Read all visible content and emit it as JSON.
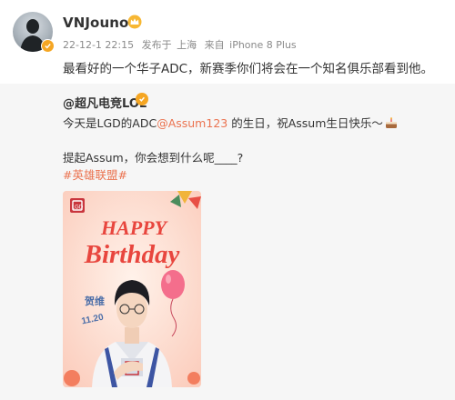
{
  "post": {
    "username": "VNJounoo",
    "date": "22-12-1 22:15",
    "source_prefix": "发布于",
    "location": "上海",
    "device_prefix": "来自",
    "device": "iPhone 8 Plus",
    "text": "最看好的一个华子ADC，新赛季你们将会在一个知名俱乐部看到他。"
  },
  "repost": {
    "author": "@超凡电竞LOL",
    "line1_prefix": "今天是LGD的ADC",
    "mention": "@Assum123",
    "line1_suffix": " 的生日，祝Assum生日快乐～",
    "line2": "提起Assum，你会想到什么呢____?",
    "topic": "#英雄联盟#",
    "image": {
      "title_happy": "HAPPY",
      "title_birthday": "Birthday",
      "player_name": "贺维",
      "player_date": "11.20",
      "logo_text": "LGD"
    }
  },
  "colors": {
    "link": "#eb7350",
    "badge": "#f5a623",
    "meta": "#8a8a8a",
    "card_background": "#fde1d6",
    "title_red": "#e8463e"
  },
  "icons": {
    "crown": "crown-icon",
    "verified": "verified-badge-icon",
    "cake": "cake-icon"
  }
}
